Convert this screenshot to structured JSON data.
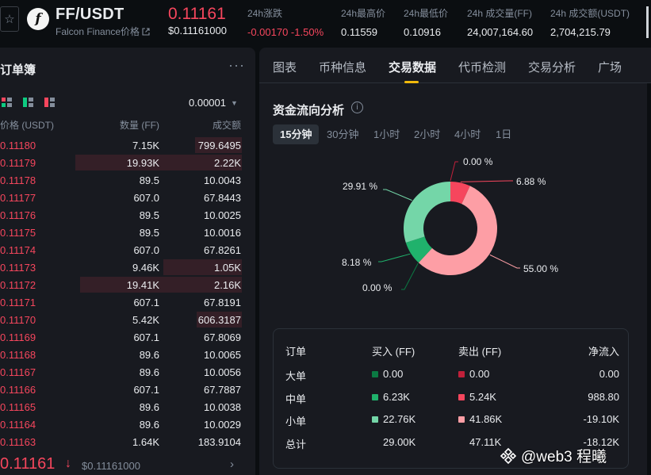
{
  "header": {
    "pair": "FF/USDT",
    "subtitle": "Falcon Finance价格",
    "price": "0.11161",
    "price_usd": "$0.11161000",
    "stats": [
      {
        "label": "24h涨跌",
        "value": "-0.00170 -1.50%",
        "negative": true
      },
      {
        "label": "24h最高价",
        "value": "0.11559"
      },
      {
        "label": "24h最低价",
        "value": "0.10916"
      },
      {
        "label": "24h 成交量(FF)",
        "value": "24,007,164.60"
      },
      {
        "label": "24h 成交额(USDT)",
        "value": "2,704,215.79"
      }
    ]
  },
  "orderbook": {
    "title": "订单簿",
    "more": "···",
    "precision": "0.00001",
    "columns": {
      "price": "价格 (USDT)",
      "qty": "数量 (FF)",
      "total": "成交额"
    },
    "rows": [
      {
        "price": "0.11180",
        "qty": "7.15K",
        "total": "799.6495",
        "depth": 0.28
      },
      {
        "price": "0.11179",
        "qty": "19.93K",
        "total": "2.22K",
        "depth": 1.0
      },
      {
        "price": "0.11178",
        "qty": "89.5",
        "total": "10.0043",
        "depth": 0.0
      },
      {
        "price": "0.11177",
        "qty": "607.0",
        "total": "67.8443",
        "depth": 0.0
      },
      {
        "price": "0.11176",
        "qty": "89.5",
        "total": "10.0025",
        "depth": 0.0
      },
      {
        "price": "0.11175",
        "qty": "89.5",
        "total": "10.0016",
        "depth": 0.0
      },
      {
        "price": "0.11174",
        "qty": "607.0",
        "total": "67.8261",
        "depth": 0.0
      },
      {
        "price": "0.11173",
        "qty": "9.46K",
        "total": "1.05K",
        "depth": 0.47
      },
      {
        "price": "0.11172",
        "qty": "19.41K",
        "total": "2.16K",
        "depth": 0.97
      },
      {
        "price": "0.11171",
        "qty": "607.1",
        "total": "67.8191",
        "depth": 0.0
      },
      {
        "price": "0.11170",
        "qty": "5.42K",
        "total": "606.3187",
        "depth": 0.27
      },
      {
        "price": "0.11169",
        "qty": "607.1",
        "total": "67.8069",
        "depth": 0.0
      },
      {
        "price": "0.11168",
        "qty": "89.6",
        "total": "10.0065",
        "depth": 0.0
      },
      {
        "price": "0.11167",
        "qty": "89.6",
        "total": "10.0056",
        "depth": 0.0
      },
      {
        "price": "0.11166",
        "qty": "607.1",
        "total": "67.7887",
        "depth": 0.0
      },
      {
        "price": "0.11165",
        "qty": "89.6",
        "total": "10.0038",
        "depth": 0.0
      },
      {
        "price": "0.11164",
        "qty": "89.6",
        "total": "10.0029",
        "depth": 0.0
      },
      {
        "price": "0.11163",
        "qty": "1.64K",
        "total": "183.9104",
        "depth": 0.0
      }
    ],
    "last_price": "0.11161",
    "last_arrow": "↓",
    "last_usd": "$0.11161000"
  },
  "tabs": [
    "图表",
    "币种信息",
    "交易数据",
    "代币检测",
    "交易分析",
    "广场"
  ],
  "active_tab": 2,
  "fund_flow": {
    "title": "资金流向分析",
    "info_icon": "i",
    "periods": [
      "15分钟",
      "30分钟",
      "1小时",
      "2小时",
      "4小时",
      "1日"
    ],
    "active_period": 0,
    "donut": [
      {
        "label": "0.00 %",
        "value": 0.0,
        "color": "#c0203a"
      },
      {
        "label": "6.88 %",
        "value": 6.88,
        "color": "#f6465d"
      },
      {
        "label": "55.00 %",
        "value": 55.0,
        "color": "#fd9ea5"
      },
      {
        "label": "0.00 %",
        "value": 0.0,
        "color": "#0b7a43"
      },
      {
        "label": "8.18 %",
        "value": 8.18,
        "color": "#20b26c"
      },
      {
        "label": "29.91 %",
        "value": 29.91,
        "color": "#74d6a8"
      }
    ],
    "table": {
      "headers": {
        "name": "订单",
        "buy": "买入 (FF)",
        "sell": "卖出 (FF)",
        "net": "净流入"
      },
      "rows": [
        {
          "name": "大单",
          "buy": "0.00",
          "sell": "0.00",
          "net": "0.00",
          "buy_color": "#0b7a43",
          "sell_color": "#c0203a"
        },
        {
          "name": "中单",
          "buy": "6.23K",
          "sell": "5.24K",
          "net": "988.80",
          "buy_color": "#20b26c",
          "sell_color": "#f6465d"
        },
        {
          "name": "小单",
          "buy": "22.76K",
          "sell": "41.86K",
          "net": "-19.10K",
          "buy_color": "#74d6a8",
          "sell_color": "#fd9ea5"
        },
        {
          "name": "总计",
          "buy": "29.00K",
          "sell": "47.11K",
          "net": "-18.12K"
        }
      ]
    }
  },
  "watermark": "@web3 程曦",
  "colors": {
    "up": "#0ecb81",
    "down": "#f6465d",
    "accent": "#f0b90b",
    "bg": "#0b0e11",
    "panel": "#181a20"
  }
}
